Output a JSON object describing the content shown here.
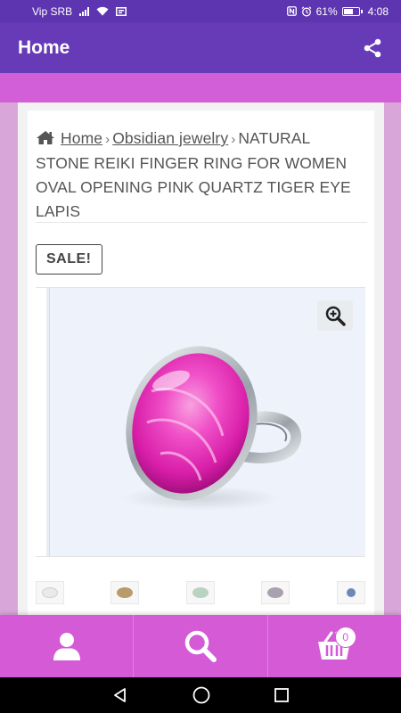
{
  "status_bar": {
    "carrier": "Vip SRB",
    "battery": "61%",
    "time": "4:08"
  },
  "app_bar": {
    "title": "Home",
    "share_icon": "share-icon"
  },
  "breadcrumb": {
    "home_icon": "home-icon",
    "items": [
      "Home",
      "Obsidian jewelry"
    ],
    "current": "NATURAL STONE REIKI FINGER RING FOR WOMEN OVAL OPENING PINK QUARTZ TIGER EYE LAPIS"
  },
  "product": {
    "badge": "SALE!",
    "zoom_icon": "zoom-in-icon",
    "image": "pink-oval-stone-ring",
    "thumbnails": [
      "white-stone-ring",
      "tiger-eye-ring",
      "green-stone-ring",
      "grey-stone-ring",
      "lapis-ring"
    ]
  },
  "bottom_nav": {
    "items": [
      "user-icon",
      "search-icon",
      "cart-icon"
    ],
    "cart_count": "0"
  },
  "colors": {
    "status_bar": "#5e35b1",
    "app_bar": "#673ab7",
    "accent_pink": "#d25fd8",
    "bottom_nav": "#d45ad6",
    "background": "#d9a6d9"
  }
}
